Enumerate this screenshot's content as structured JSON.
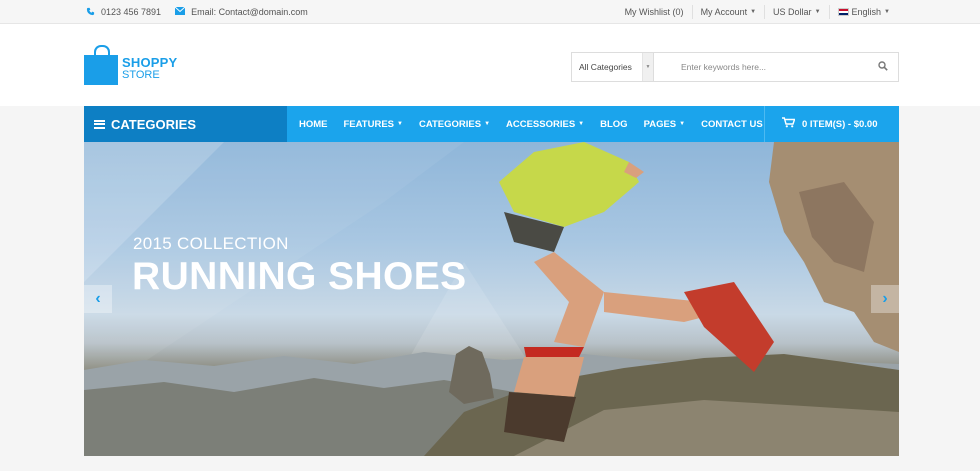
{
  "topbar": {
    "phone": "0123 456 7891",
    "email": "Email: Contact@domain.com",
    "wishlist": "My Wishlist (0)",
    "account": "My Account",
    "currency": "US Dollar",
    "language": "English"
  },
  "logo": {
    "line1": "SHOPPY",
    "line2": "STORE"
  },
  "search": {
    "category": "All Categories",
    "placeholder": "Enter keywords here..."
  },
  "nav": {
    "categories_label": "CATEGORIES",
    "items": [
      {
        "label": "HOME"
      },
      {
        "label": "FEATURES"
      },
      {
        "label": "CATEGORIES"
      },
      {
        "label": "ACCESSORIES"
      },
      {
        "label": "BLOG"
      },
      {
        "label": "PAGES"
      },
      {
        "label": "CONTACT US"
      }
    ],
    "cart": "0 ITEM(S) - $0.00"
  },
  "hero": {
    "subtitle": "2015 COLLECTION",
    "title": "RUNNING SHOES"
  },
  "colors": {
    "accent": "#1ba4ec",
    "accent_dark": "#0d7fc4"
  }
}
